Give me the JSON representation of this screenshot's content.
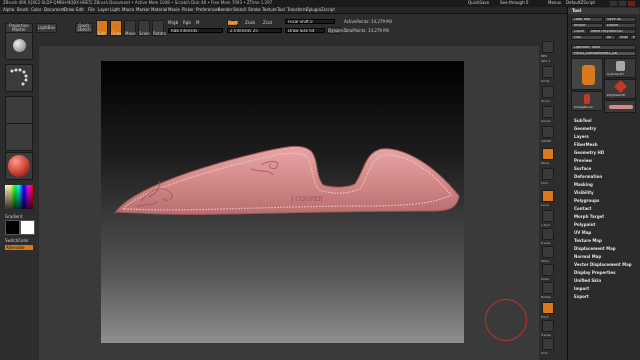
{
  "titlebar": {
    "title": "ZBrush 4R6  [QXE2-SLDP-QMBH-NQBX-HBE5]  ZBrush Document  • Active Mem 1048 • Scratch Disk 48 • Free Mem 7093 • ZTime 1.297",
    "quicksave": "QuickSave",
    "seethrough": "See-through   0",
    "menus": "Menus",
    "defaultzscript": "DefaultZScript"
  },
  "menubar": [
    "Alpha",
    "Brush",
    "Color",
    "Document",
    "Draw",
    "Edit",
    "File",
    "Layer",
    "Light",
    "Macro",
    "Marker",
    "Material",
    "Movie",
    "Picker",
    "Preferences",
    "Render",
    "Stencil",
    "Stroke",
    "Texture",
    "Tool",
    "Transform",
    "Zplugin",
    "Zscript"
  ],
  "topshelf": {
    "projection_master": "Projection Master",
    "lightbox": "LightBox",
    "quick_sketch": "Quick Sketch",
    "edit": "Edit",
    "draw": "Draw",
    "move": "Move",
    "scale": "Scale",
    "rotate": "Rotate",
    "mrgb": "Mrgb",
    "rgb": "Rgb",
    "m": "M",
    "rgb_intensity": "Rgb Intensity",
    "zadd": "Zadd",
    "zsub": "Zsub",
    "zcut": "Zcut",
    "z_intensity": "Z Intensity 25",
    "focal_shift": "Focal Shift 0",
    "draw_size": "Draw Size 64",
    "dynamic": "Dynamic",
    "active_points": "ActivePoints: 14,279 Mil",
    "total_points": "TotalPoints: 14,279 Mil"
  },
  "leftshelf": {
    "gradient": "Gradient",
    "switch_color": "SwitchColor",
    "alternate": "Alternate",
    "colors": {
      "primary": "#000000",
      "secondary": "#ffffff",
      "accent": "#d9781e"
    }
  },
  "rightshelf": {
    "labels": [
      "BPR",
      "SPix 3",
      "Scroll",
      "Zoom",
      "Actual",
      "AAHalf",
      "Persp",
      "Floor",
      "Local",
      "L.Sym",
      "Frame",
      "Move",
      "Scale",
      "Rotate",
      "PolyF",
      "Transp",
      "Ghost",
      "Solo",
      "Xpose"
    ]
  },
  "tool_palette": {
    "header": "Tool",
    "load_tool": "Load Tool",
    "save_as": "Save As",
    "import": "Import",
    "export": "Export",
    "clone": "Clone",
    "make_polymesh3d": "Make PolyMesh3D",
    "goz": "GoZ",
    "all": "All",
    "visible": "Visible",
    "r": "R",
    "lightbox_tools": "Lightbox› Tools",
    "current_tool": "PM3D_ExtrudeKnife1_48",
    "tool_names": [
      "Cylinder3D",
      "PolyMesh3D",
      "SimpleBrush"
    ],
    "sections": [
      "SubTool",
      "Geometry",
      "Layers",
      "FiberMesh",
      "Geometry HD",
      "Preview",
      "Surface",
      "Deformation",
      "Masking",
      "Visibility",
      "Polygroups",
      "Contact",
      "Morph Target",
      "Polypaint",
      "UV Map",
      "Texture Map",
      "Displacement Map",
      "Normal Map",
      "Vector Displacement Map",
      "Display Properties",
      "Unified Skin",
      "Import",
      "Export"
    ]
  },
  "canvas": {
    "engraving_text": "J COOPER",
    "object_color": "#d58a8a"
  }
}
